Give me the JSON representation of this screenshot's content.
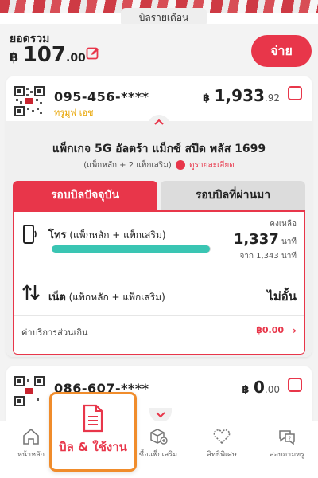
{
  "header": {
    "month_tab": "บิลรายเดือน",
    "total_label": "ยอดรวม",
    "total_currency": "฿",
    "total_int": "107",
    "total_dec": ".00",
    "pay_button": "จ่าย"
  },
  "account1": {
    "phone": "095-456-****",
    "brand": "ทรูมูฟ เอช",
    "amount_currency": "฿",
    "amount_int": "1,933",
    "amount_dec": ".92",
    "package_title": "แพ็กเกจ 5G อัลตร้า แม็กซ์ สปีด พลัส 1699",
    "package_sub": "(แพ็กหลัก + 2 แพ็กเสริม)",
    "details_link": "ดูรายละเอียด",
    "tabs": [
      "รอบบิลปัจจุบัน",
      "รอบบิลที่ผ่านมา"
    ],
    "voice": {
      "label_bold": "โทร",
      "label_rest": " (แพ็กหลัก + แพ็กเสริม)",
      "remain_label": "คงเหลือ",
      "remain_value": "1,337",
      "remain_unit": " นาที",
      "total_text": "จาก 1,343 นาที",
      "progress_fraction": 0.9955
    },
    "internet": {
      "label_bold": "เน็ต",
      "label_rest": " (แพ็กหลัก + แพ็กเสริม)",
      "value": "ไม่อั้น"
    },
    "extra": {
      "label": "ค่าบริการส่วนเกิน",
      "value": "฿0.00"
    }
  },
  "account2": {
    "phone": "086-607-****",
    "amount_currency": "฿",
    "amount_int": "0",
    "amount_dec": ".00"
  },
  "nav": {
    "items": [
      "หน้าหลัก",
      "บิล & ใช้งาน",
      "ซื้อแพ็กเสริม",
      "สิทธิพิเศษ",
      "สอบถามทรู"
    ]
  },
  "colors": {
    "accent": "#e8364a",
    "progress": "#3ac5b3",
    "brand_yellow": "#e8a400",
    "highlight": "#f08c2b"
  }
}
